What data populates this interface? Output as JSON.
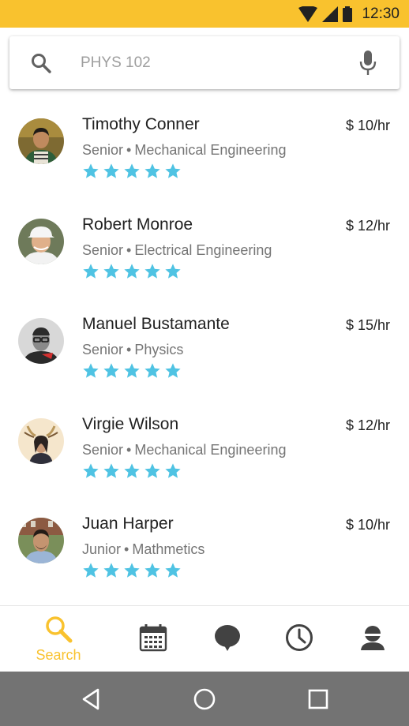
{
  "status_bar": {
    "time": "12:30",
    "color": "#F9C22E"
  },
  "search": {
    "placeholder": "PHYS 102"
  },
  "tutors": [
    {
      "name": "Timothy Conner",
      "year": "Senior",
      "major": "Mechanical Engineering",
      "rate": "$ 10/hr",
      "rating": 5
    },
    {
      "name": "Robert Monroe",
      "year": "Senior",
      "major": "Electrical Engineering",
      "rate": "$ 12/hr",
      "rating": 5
    },
    {
      "name": "Manuel Bustamante",
      "year": "Senior",
      "major": "Physics",
      "rate": "$ 15/hr",
      "rating": 5
    },
    {
      "name": "Virgie Wilson",
      "year": "Senior",
      "major": "Mechanical Engineering",
      "rate": "$ 12/hr",
      "rating": 5
    },
    {
      "name": "Juan Harper",
      "year": "Junior",
      "major": "Mathmetics",
      "rate": "$ 10/hr",
      "rating": 5
    }
  ],
  "separator": "•",
  "star_color": "#4FC3E3",
  "bottom_nav": {
    "search_label": "Search",
    "active": "search",
    "icons": [
      "search-icon",
      "calendar-icon",
      "chat-icon",
      "history-icon",
      "profile-icon"
    ]
  },
  "system_nav": {
    "icons": [
      "back-icon",
      "home-icon",
      "recents-icon"
    ]
  }
}
